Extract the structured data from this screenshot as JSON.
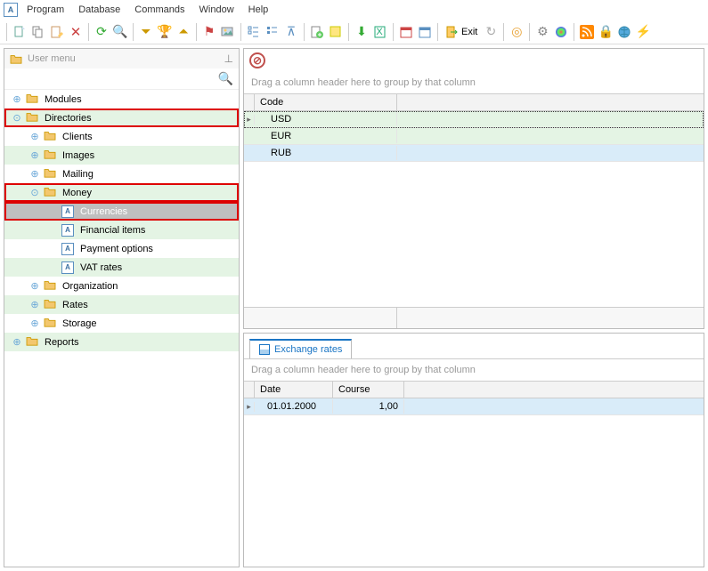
{
  "menubar": {
    "items": [
      "Program",
      "Database",
      "Commands",
      "Window",
      "Help"
    ]
  },
  "toolbar": {
    "exit_label": "Exit"
  },
  "sidebar": {
    "title": "User menu",
    "tree": [
      {
        "label": "Modules",
        "level": 0,
        "kind": "folder",
        "expand": "plus",
        "stripe": "white",
        "hl": false,
        "sel": false
      },
      {
        "label": "Directories",
        "level": 0,
        "kind": "folder",
        "expand": "down",
        "stripe": "green",
        "hl": true,
        "sel": false
      },
      {
        "label": "Clients",
        "level": 1,
        "kind": "folder",
        "expand": "plus",
        "stripe": "white",
        "hl": false,
        "sel": false
      },
      {
        "label": "Images",
        "level": 1,
        "kind": "folder",
        "expand": "plus",
        "stripe": "green",
        "hl": false,
        "sel": false
      },
      {
        "label": "Mailing",
        "level": 1,
        "kind": "folder",
        "expand": "plus",
        "stripe": "white",
        "hl": false,
        "sel": false
      },
      {
        "label": "Money",
        "level": 1,
        "kind": "folder",
        "expand": "down",
        "stripe": "green",
        "hl": true,
        "sel": false
      },
      {
        "label": "Currencies",
        "level": 2,
        "kind": "doc",
        "expand": "",
        "stripe": "white",
        "hl": true,
        "sel": true
      },
      {
        "label": "Financial items",
        "level": 2,
        "kind": "doc",
        "expand": "",
        "stripe": "green",
        "hl": false,
        "sel": false
      },
      {
        "label": "Payment options",
        "level": 2,
        "kind": "doc",
        "expand": "",
        "stripe": "white",
        "hl": false,
        "sel": false
      },
      {
        "label": "VAT rates",
        "level": 2,
        "kind": "doc",
        "expand": "",
        "stripe": "green",
        "hl": false,
        "sel": false
      },
      {
        "label": "Organization",
        "level": 1,
        "kind": "folder",
        "expand": "plus",
        "stripe": "white",
        "hl": false,
        "sel": false
      },
      {
        "label": "Rates",
        "level": 1,
        "kind": "folder",
        "expand": "plus",
        "stripe": "green",
        "hl": false,
        "sel": false
      },
      {
        "label": "Storage",
        "level": 1,
        "kind": "folder",
        "expand": "plus",
        "stripe": "white",
        "hl": false,
        "sel": false
      },
      {
        "label": "Reports",
        "level": 0,
        "kind": "folder",
        "expand": "plus",
        "stripe": "green",
        "hl": false,
        "sel": false
      }
    ]
  },
  "grid_top": {
    "group_hint": "Drag a column header here to group by that column",
    "col": "Code",
    "rows": [
      {
        "v": "USD",
        "cls": "g-green g-sel"
      },
      {
        "v": "EUR",
        "cls": "g-green"
      },
      {
        "v": "RUB",
        "cls": "g-blue"
      }
    ]
  },
  "bottom": {
    "tab_label": "Exchange rates",
    "group_hint": "Drag a column header here to group by that column",
    "cols": [
      "Date",
      "Course"
    ],
    "rows": [
      {
        "date": "01.01.2000",
        "course": "1,00",
        "cls": "g-blue"
      }
    ]
  }
}
